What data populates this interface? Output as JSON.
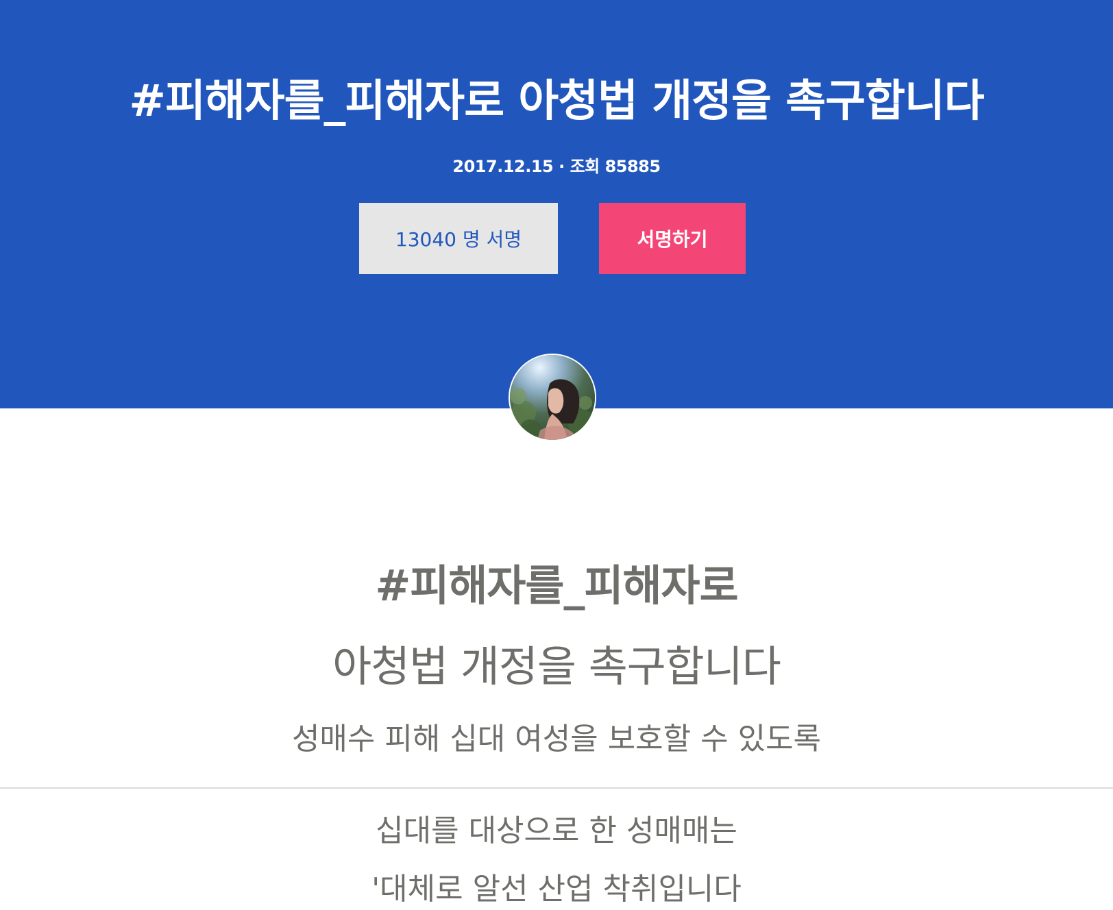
{
  "header": {
    "title": "#피해자를_피해자로 아청법 개정을 촉구합니다",
    "meta": "2017.12.15 · 조회 85885",
    "signature_count_label": "13040 명 서명",
    "sign_button_label": "서명하기"
  },
  "author": {
    "avatar": "profile-photo"
  },
  "content": {
    "heading_line1": "#피해자를_피해자로",
    "heading_line2": "아청법 개정을 촉구합니다",
    "subheading": "성매수 피해 십대 여성을 보호할 수 있도록",
    "body_line1": "십대를 대상으로 한 성매매는",
    "body_line2": "'대체로 알선 산업 착취입니다"
  },
  "colors": {
    "hero_background": "#2157bd",
    "sign_button": "#f44676",
    "count_button": "#e6e6e6",
    "body_text": "#6e6e6a"
  }
}
